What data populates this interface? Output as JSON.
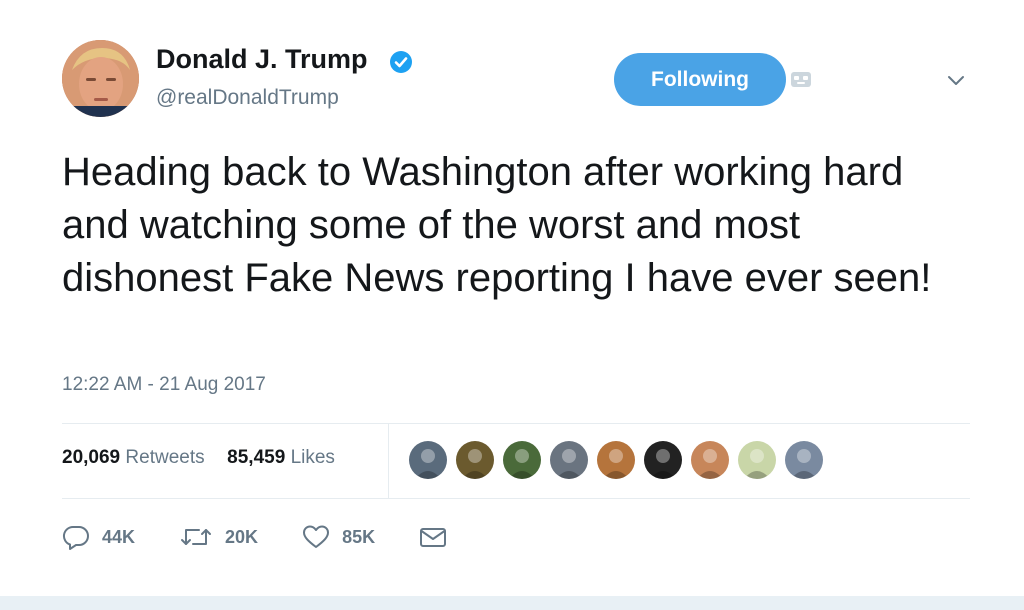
{
  "author": {
    "display_name": "Donald J. Trump",
    "handle": "@realDonaldTrump",
    "verified": true,
    "avatar_icon": "profile-photo-avatar"
  },
  "header": {
    "follow_button_label": "Following",
    "notification_icon": "robot-notification-icon",
    "menu_icon": "chevron-down-icon"
  },
  "tweet": {
    "text": "Heading back to Washington after working hard and watching some of the worst and most dishonest Fake News reporting I have ever seen!",
    "timestamp": "12:22 AM - 21 Aug 2017"
  },
  "stats": {
    "retweets_count": "20,069",
    "retweets_label": "Retweets",
    "likes_count": "85,459",
    "likes_label": "Likes",
    "liker_avatars": [
      {
        "name": "liker-avatar-1",
        "color": "#5a6b7c"
      },
      {
        "name": "liker-avatar-2",
        "color": "#6b5a2e"
      },
      {
        "name": "liker-avatar-3",
        "color": "#4a6a3a"
      },
      {
        "name": "liker-avatar-4",
        "color": "#6a7480"
      },
      {
        "name": "liker-avatar-5",
        "color": "#b5743c"
      },
      {
        "name": "liker-avatar-6",
        "color": "#222222"
      },
      {
        "name": "liker-avatar-7",
        "color": "#c7865a"
      },
      {
        "name": "liker-avatar-8",
        "color": "#c9d6a8"
      },
      {
        "name": "liker-avatar-9",
        "color": "#7a8aa0"
      }
    ]
  },
  "actions": {
    "reply_count": "44K",
    "retweet_count": "20K",
    "like_count": "85K",
    "reply_icon": "reply-icon",
    "retweet_icon": "retweet-icon",
    "like_icon": "heart-icon",
    "message_icon": "envelope-icon"
  },
  "colors": {
    "accent": "#4aa3e6",
    "verified_badge": "#1da1f2",
    "secondary_text": "#657786",
    "primary_text": "#14171a"
  }
}
